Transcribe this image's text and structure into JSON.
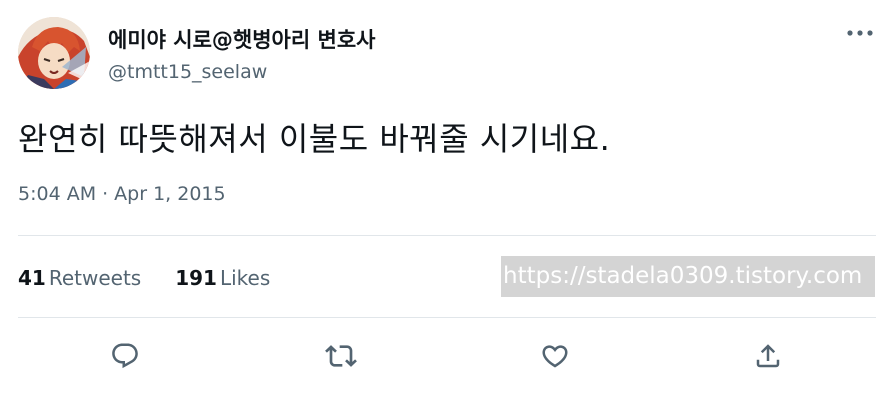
{
  "user": {
    "display_name": "에미야 시로@햇병아리 변호사",
    "handle": "@tmtt15_seelaw"
  },
  "tweet": {
    "text": "완연히 따뜻해져서 이불도 바꿔줄 시기네요.",
    "time": "5:04 AM",
    "separator": "·",
    "date": "Apr 1, 2015"
  },
  "stats": {
    "retweets_count": "41",
    "retweets_label": "Retweets",
    "likes_count": "191",
    "likes_label": "Likes"
  },
  "watermark": "https://stadela0309.tistory.com",
  "icons": {
    "more": "more-horizontal-icon",
    "reply": "reply-icon",
    "retweet": "retweet-icon",
    "like": "heart-icon",
    "share": "share-icon"
  },
  "colors": {
    "text_primary": "#0f1419",
    "text_secondary": "#536471",
    "divider": "#e1e6ea"
  }
}
